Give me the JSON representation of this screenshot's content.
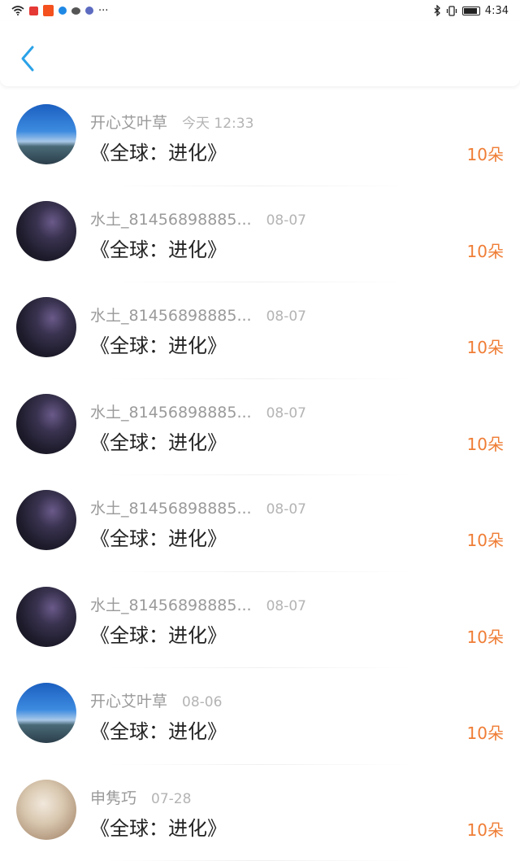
{
  "status_bar": {
    "time": "4:34",
    "overflow": "···"
  },
  "header": {
    "back_icon": "chevron-left-icon",
    "accent": "#2aa2e8"
  },
  "colors": {
    "amount": "#ef7d35",
    "name": "#9a9a9a",
    "time": "#b4b4b4"
  },
  "rows": [
    {
      "name": "开心艾叶草",
      "time": "今天 12:33",
      "title": "《全球：进化》",
      "amount": "10朵",
      "avatar": "sky"
    },
    {
      "name": "水土_81456898885...",
      "time": "08-07",
      "title": "《全球：进化》",
      "amount": "10朵",
      "avatar": "night"
    },
    {
      "name": "水土_81456898885...",
      "time": "08-07",
      "title": "《全球：进化》",
      "amount": "10朵",
      "avatar": "night"
    },
    {
      "name": "水土_81456898885...",
      "time": "08-07",
      "title": "《全球：进化》",
      "amount": "10朵",
      "avatar": "night"
    },
    {
      "name": "水土_81456898885...",
      "time": "08-07",
      "title": "《全球：进化》",
      "amount": "10朵",
      "avatar": "night"
    },
    {
      "name": "水土_81456898885...",
      "time": "08-07",
      "title": "《全球：进化》",
      "amount": "10朵",
      "avatar": "night"
    },
    {
      "name": "开心艾叶草",
      "time": "08-06",
      "title": "《全球：进化》",
      "amount": "10朵",
      "avatar": "sky"
    },
    {
      "name": "申隽巧",
      "time": "07-28",
      "title": "《全球：进化》",
      "amount": "10朵",
      "avatar": "person"
    }
  ]
}
